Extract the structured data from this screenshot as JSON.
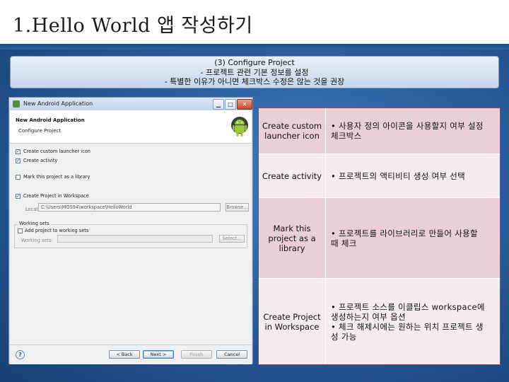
{
  "slide": {
    "title": "1.Hello World 앱 작성하기"
  },
  "banner": {
    "line1": "(3) Configure Project",
    "line2": "- 프로젝트 관련 기본 정보를 설정",
    "line3": "- 특별한 이유가 아니면 체크박스 수정은 않는 것을 권장"
  },
  "dialog": {
    "window_title": "New Android Application",
    "header_title": "New Android Application",
    "header_subtitle": "Configure Project",
    "options": [
      {
        "label": "Create custom launcher icon",
        "checked": true
      },
      {
        "label": "Create activity",
        "checked": true
      },
      {
        "label": "Mark this project as a library",
        "checked": false
      },
      {
        "label": "Create Project in Workspace",
        "checked": true
      }
    ],
    "location_label": "Location:",
    "location_value": "C:\\Users\\MOS94\\workspace\\HelloWorld",
    "browse_label": "Browse...",
    "working_sets": {
      "title": "Working sets",
      "add_label": "Add project to working sets",
      "sets_label": "Working sets:",
      "select_label": "Select..."
    },
    "buttons": {
      "back": "< Back",
      "next": "Next >",
      "finish": "Finish",
      "cancel": "Cancel"
    }
  },
  "table": {
    "rows": [
      {
        "option": "Create custom launcher icon",
        "desc_lines": [
          "• 사용자 정의 아이콘을 사용할지 여부 설정",
          "체크박스"
        ]
      },
      {
        "option": "Create activity",
        "desc_lines": [
          "• 프로젝트의 액티비티 생성 여부 선택"
        ]
      },
      {
        "option": "Mark this project as a library",
        "desc_lines": [
          "• 프로젝트를 라이브러리로 만들어 사용할",
          "때 체크"
        ]
      },
      {
        "option": "Create Project in Workspace",
        "desc_lines": [
          "• 프로젝트 소스를 이클립스 workspace에",
          "생성하는지 여부 옵션",
          "• 체크 해제시에는 원하는 위치 프로젝트 생",
          "성 가능"
        ]
      }
    ]
  },
  "colors": {
    "background": "#2a5d9d",
    "table_border": "#a24050",
    "table_fill": "#ead0d6"
  }
}
